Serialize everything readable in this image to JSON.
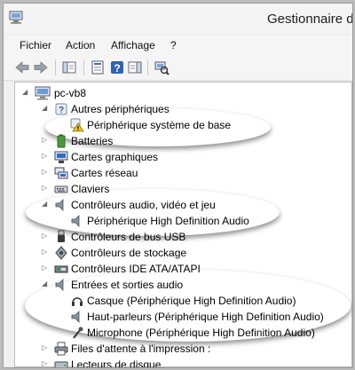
{
  "window": {
    "title": "Gestionnaire de"
  },
  "menu": [
    "Fichier",
    "Action",
    "Affichage",
    "?"
  ],
  "toolbar": {
    "buttons": [
      "back-icon",
      "forward-icon",
      "show-hide-console-tree-icon",
      "properties-icon",
      "help-icon",
      "show-action-pane-icon",
      "scan-hardware-icon"
    ]
  },
  "tree": {
    "root": "pc-vb8",
    "items": [
      {
        "label": "Autres périphériques",
        "expanded": true,
        "icon": "unknown-device-icon"
      },
      {
        "label": "Périphérique système de base",
        "icon": "warning-device-icon"
      },
      {
        "label": "Batteries",
        "expanded": false,
        "icon": "battery-icon"
      },
      {
        "label": "Cartes graphiques",
        "expanded": false,
        "icon": "display-adapter-icon"
      },
      {
        "label": "Cartes réseau",
        "expanded": false,
        "icon": "network-adapter-icon"
      },
      {
        "label": "Claviers",
        "expanded": false,
        "icon": "keyboard-icon"
      },
      {
        "label": "Contrôleurs audio, vidéo et jeu",
        "expanded": true,
        "icon": "speaker-icon"
      },
      {
        "label": "Périphérique High Definition Audio",
        "icon": "speaker-icon"
      },
      {
        "label": "Contrôleurs de bus USB",
        "expanded": false,
        "icon": "usb-icon"
      },
      {
        "label": "Contrôleurs de stockage",
        "expanded": false,
        "icon": "storage-controller-icon"
      },
      {
        "label": "Contrôleurs IDE ATA/ATAPI",
        "expanded": false,
        "icon": "ide-controller-icon"
      },
      {
        "label": "Entrées et sorties audio",
        "expanded": true,
        "icon": "speaker-icon"
      },
      {
        "label": "Casque (Périphérique High Definition Audio)",
        "icon": "headphones-icon"
      },
      {
        "label": "Haut-parleurs (Périphérique High Definition Audio)",
        "icon": "speaker-icon"
      },
      {
        "label": "Microphone (Périphérique High Definition Audio)",
        "icon": "microphone-icon"
      },
      {
        "label": "Files d'attente à l'impression :",
        "expanded": false,
        "icon": "printer-icon"
      },
      {
        "label": "Lecteurs de disque",
        "expanded": false,
        "icon": "disk-drive-icon"
      }
    ]
  }
}
